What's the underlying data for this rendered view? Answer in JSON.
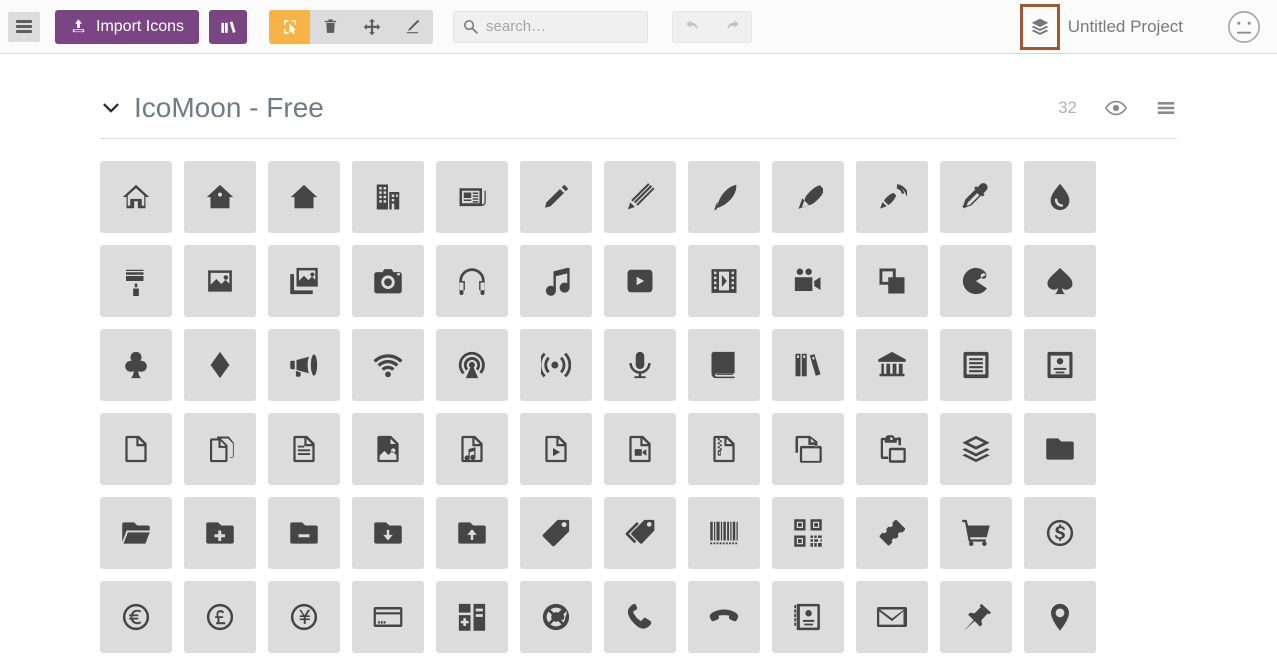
{
  "toolbar": {
    "menu_label": "menu-toggle",
    "import_label": "Import Icons",
    "library_label": "library",
    "tools": [
      {
        "name": "select",
        "label": "Select",
        "active": true
      },
      {
        "name": "delete",
        "label": "Delete",
        "active": false
      },
      {
        "name": "move",
        "label": "Move",
        "active": false
      },
      {
        "name": "edit",
        "label": "Edit",
        "active": false
      }
    ],
    "undo_label": "Undo",
    "redo_label": "Redo",
    "accent_purple": "#7a4583",
    "accent_orange": "#f5b445",
    "focus_outline": "#a05a30"
  },
  "search": {
    "value": "",
    "placeholder": "search…",
    "icon": "search-icon"
  },
  "project": {
    "name": "Untitled Project",
    "icon": "stack-icon",
    "face_icon": "neutral-face-icon"
  },
  "set": {
    "title": "IcoMoon - Free",
    "count": "32",
    "chevron": "chevron-down-icon",
    "eye_icon": "eye-icon",
    "menu_icon": "list-menu-icon"
  },
  "icons": [
    {
      "name": "home"
    },
    {
      "name": "home2"
    },
    {
      "name": "home3"
    },
    {
      "name": "office"
    },
    {
      "name": "newspaper"
    },
    {
      "name": "pencil"
    },
    {
      "name": "pencil2"
    },
    {
      "name": "quill"
    },
    {
      "name": "pen"
    },
    {
      "name": "blog"
    },
    {
      "name": "eyedropper"
    },
    {
      "name": "droplet"
    },
    {
      "name": "paint-format"
    },
    {
      "name": "image"
    },
    {
      "name": "images"
    },
    {
      "name": "camera"
    },
    {
      "name": "headphones"
    },
    {
      "name": "music"
    },
    {
      "name": "play"
    },
    {
      "name": "film"
    },
    {
      "name": "video-camera"
    },
    {
      "name": "dice"
    },
    {
      "name": "pacman"
    },
    {
      "name": "spades"
    },
    {
      "name": "clubs"
    },
    {
      "name": "diamonds"
    },
    {
      "name": "bullhorn"
    },
    {
      "name": "connection"
    },
    {
      "name": "podcast"
    },
    {
      "name": "feed"
    },
    {
      "name": "mic"
    },
    {
      "name": "book"
    },
    {
      "name": "books"
    },
    {
      "name": "library"
    },
    {
      "name": "file-text"
    },
    {
      "name": "profile"
    },
    {
      "name": "file-empty"
    },
    {
      "name": "files-empty"
    },
    {
      "name": "file-text2"
    },
    {
      "name": "file-picture"
    },
    {
      "name": "file-music"
    },
    {
      "name": "file-play"
    },
    {
      "name": "file-video"
    },
    {
      "name": "file-zip"
    },
    {
      "name": "copy"
    },
    {
      "name": "paste"
    },
    {
      "name": "stack"
    },
    {
      "name": "folder"
    },
    {
      "name": "folder-open"
    },
    {
      "name": "folder-plus"
    },
    {
      "name": "folder-minus"
    },
    {
      "name": "folder-download"
    },
    {
      "name": "folder-upload"
    },
    {
      "name": "price-tag"
    },
    {
      "name": "price-tags"
    },
    {
      "name": "barcode"
    },
    {
      "name": "qrcode"
    },
    {
      "name": "ticket"
    },
    {
      "name": "cart"
    },
    {
      "name": "coin-dollar"
    },
    {
      "name": "coin-euro"
    },
    {
      "name": "coin-pound"
    },
    {
      "name": "coin-yen"
    },
    {
      "name": "credit-card"
    },
    {
      "name": "calculator"
    },
    {
      "name": "lifebuoy"
    },
    {
      "name": "phone"
    },
    {
      "name": "phone-hang-up"
    },
    {
      "name": "address-book"
    },
    {
      "name": "envelop"
    },
    {
      "name": "pushpin"
    },
    {
      "name": "location"
    }
  ]
}
